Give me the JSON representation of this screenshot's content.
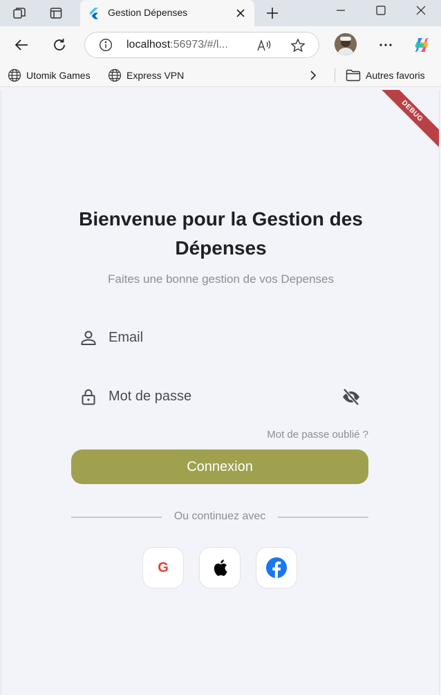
{
  "browser": {
    "tab": {
      "title": "Gestion Dépenses"
    },
    "address": {
      "host": "localhost",
      "rest": ":56973/#/l..."
    },
    "bookmarks": [
      {
        "label": "Utomik Games"
      },
      {
        "label": "Express VPN"
      }
    ],
    "other_favorites": "Autres favoris"
  },
  "app": {
    "debug_label": "DEBUG",
    "title": "Bienvenue pour la Gestion des Dépenses",
    "subtitle": "Faites une bonne gestion de vos Depenses",
    "email_placeholder": "Email",
    "password_placeholder": "Mot de passe",
    "forgot_password": "Mot de passe oublié ?",
    "login_button": "Connexion",
    "divider_text": "Ou continuez avec",
    "social": {
      "google_letter": "G",
      "google_color": "#e04436",
      "apple_icon": "apple-icon",
      "facebook_icon": "facebook-icon",
      "facebook_color": "#1877f2"
    },
    "accent_color": "#9fa14e"
  }
}
